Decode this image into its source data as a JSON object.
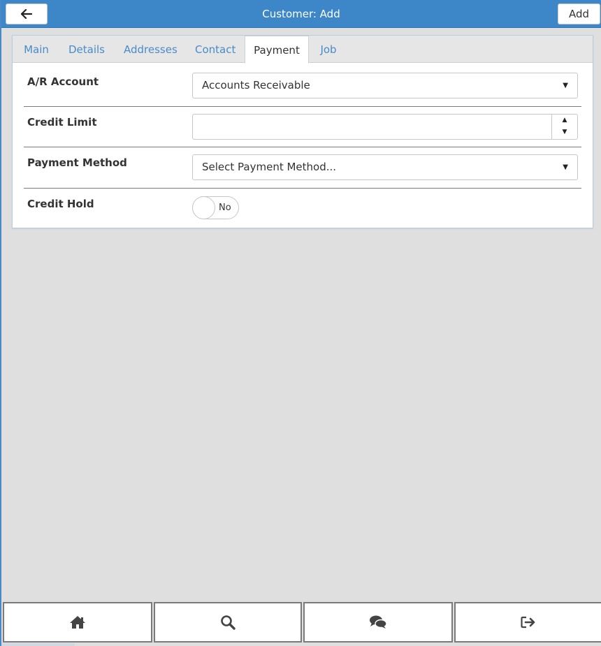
{
  "header": {
    "title": "Customer: Add",
    "back_icon": "arrow-left-icon",
    "add_label": "Add",
    "color": "#3d87c8"
  },
  "tabs": [
    {
      "label": "Main",
      "active": false
    },
    {
      "label": "Details",
      "active": false
    },
    {
      "label": "Addresses",
      "active": false
    },
    {
      "label": "Contact",
      "active": false
    },
    {
      "label": "Payment",
      "active": true
    },
    {
      "label": "Job",
      "active": false
    }
  ],
  "form": {
    "ar_account": {
      "label": "A/R Account",
      "value": "Accounts Receivable"
    },
    "credit_limit": {
      "label": "Credit Limit",
      "value": ""
    },
    "payment_method": {
      "label": "Payment Method",
      "value": "Select Payment Method..."
    },
    "credit_hold": {
      "label": "Credit Hold",
      "value": "No"
    }
  },
  "bottom_nav": [
    {
      "icon": "home-icon"
    },
    {
      "icon": "search-icon"
    },
    {
      "icon": "chat-icon"
    },
    {
      "icon": "logout-icon"
    }
  ],
  "colors": {
    "accent": "#3d87c8",
    "tab_link": "#4a8bc9",
    "background": "#dfdfdf"
  }
}
